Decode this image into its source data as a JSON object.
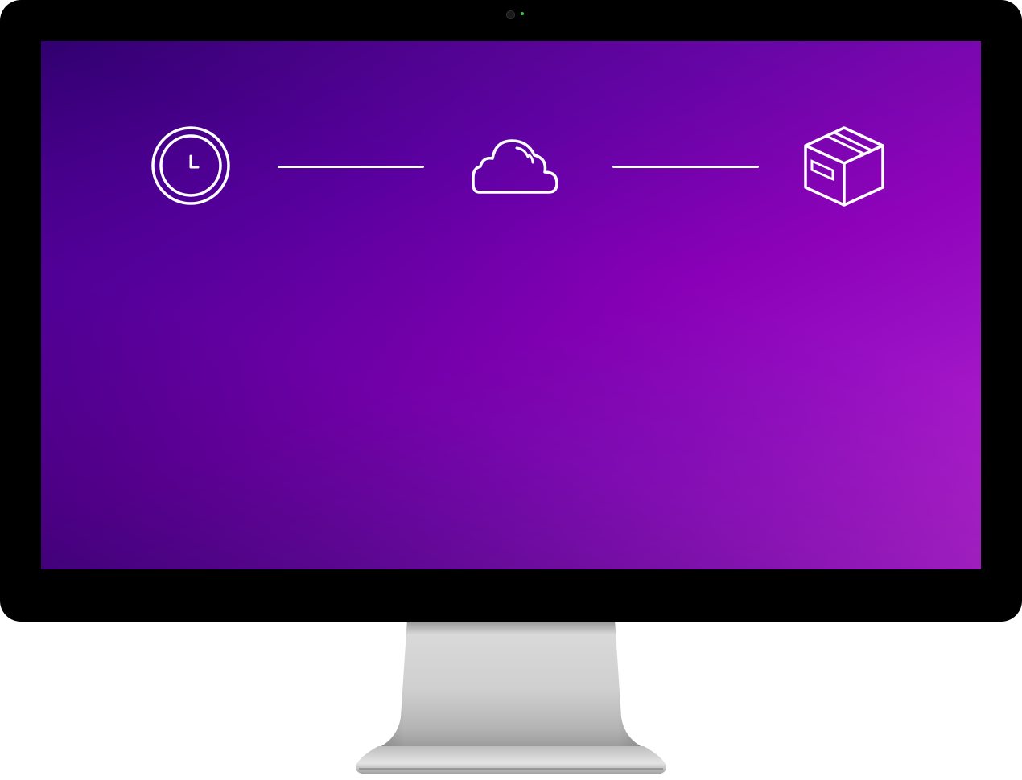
{
  "screen": {
    "gradient_colors": [
      "#300070",
      "#8a00b8",
      "#c02ad0"
    ],
    "steps": [
      {
        "icon": "clock-icon"
      },
      {
        "icon": "cloud-icon"
      },
      {
        "icon": "package-box-icon"
      }
    ],
    "connector_color": "#ffffff"
  },
  "device": {
    "type": "desktop-monitor",
    "bezel_color": "#000000",
    "camera_led_color": "#2ecc40",
    "stand_color": "#c8c8c8"
  }
}
